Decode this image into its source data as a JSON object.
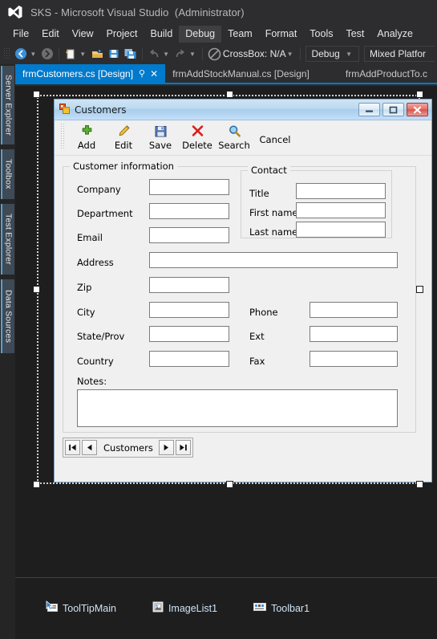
{
  "window": {
    "title": "SKS - Microsoft Visual Studio",
    "admin_suffix": "(Administrator)",
    "logo_icon": "visual-studio-logo-icon"
  },
  "menubar": {
    "items": [
      {
        "label": "File",
        "active": false
      },
      {
        "label": "Edit",
        "active": false
      },
      {
        "label": "View",
        "active": false
      },
      {
        "label": "Project",
        "active": false
      },
      {
        "label": "Build",
        "active": false
      },
      {
        "label": "Debug",
        "active": true
      },
      {
        "label": "Team",
        "active": false
      },
      {
        "label": "Format",
        "active": false
      },
      {
        "label": "Tools",
        "active": false
      },
      {
        "label": "Test",
        "active": false
      },
      {
        "label": "Analyze",
        "active": false
      }
    ]
  },
  "toolbar": {
    "nav_back_icon": "navigate-back-icon",
    "nav_forward_icon": "navigate-forward-icon",
    "new_project_icon": "new-project-icon",
    "open_file_icon": "open-file-icon",
    "save_icon": "save-icon",
    "save_all_icon": "save-all-icon",
    "undo_icon": "undo-icon",
    "redo_icon": "redo-icon",
    "start_icon": "start-debug-disabled-icon",
    "start_label": "CrossBox: N/A",
    "configuration": "Debug",
    "platform": "Mixed Platfor"
  },
  "left_dock": {
    "tabs": [
      {
        "label": "Server Explorer"
      },
      {
        "label": "Toolbox"
      },
      {
        "label": "Test Explorer"
      },
      {
        "label": "Data Sources"
      }
    ]
  },
  "tabstrip": {
    "tabs": [
      {
        "label": "frmCustomers.cs [Design]",
        "active": true,
        "pin_icon": "pin-icon",
        "close_icon": "close-icon"
      },
      {
        "label": "frmAddStockManual.cs [Design]",
        "active": false
      },
      {
        "label": "frmAddProductTo.c",
        "active": false
      }
    ]
  },
  "form": {
    "icon": "windows-form-icon",
    "title": "Customers",
    "titlebar_buttons": [
      {
        "name": "minimize",
        "glyph": "minimize-icon"
      },
      {
        "name": "maximize",
        "glyph": "maximize-icon"
      },
      {
        "name": "close",
        "glyph": "close-icon"
      }
    ],
    "toolbar": [
      {
        "label": "Add",
        "icon": "add-plus-icon"
      },
      {
        "label": "Edit",
        "icon": "edit-pencil-icon"
      },
      {
        "label": "Save",
        "icon": "save-floppy-icon"
      },
      {
        "label": "Delete",
        "icon": "delete-x-icon"
      },
      {
        "label": "Search",
        "icon": "search-magnifier-icon"
      },
      {
        "label": "Cancel",
        "icon": ""
      }
    ],
    "customer_group": {
      "title": "Customer information",
      "fields": [
        {
          "label": "Company",
          "value": ""
        },
        {
          "label": "Department",
          "value": ""
        },
        {
          "label": "Email",
          "value": ""
        },
        {
          "label": "Address",
          "value": ""
        },
        {
          "label": "Zip",
          "value": ""
        },
        {
          "label": "City",
          "value": ""
        },
        {
          "label": "State/Prov",
          "value": ""
        },
        {
          "label": "Country",
          "value": ""
        }
      ],
      "notes_label": "Notes:",
      "notes_value": ""
    },
    "contact_group": {
      "title": "Contact",
      "fields": [
        {
          "label": "Title",
          "value": ""
        },
        {
          "label": "First name",
          "value": ""
        },
        {
          "label": "Last name",
          "value": ""
        }
      ]
    },
    "phone_fields": [
      {
        "label": "Phone",
        "value": ""
      },
      {
        "label": "Ext",
        "value": ""
      },
      {
        "label": "Fax",
        "value": ""
      }
    ],
    "navigator": {
      "first_icon": "move-first-icon",
      "prev_icon": "move-previous-icon",
      "label": "Customers",
      "next_icon": "move-next-icon",
      "last_icon": "move-last-icon"
    }
  },
  "component_tray": {
    "items": [
      {
        "label": "ToolTipMain",
        "icon": "tooltip-component-icon"
      },
      {
        "label": "ImageList1",
        "icon": "imagelist-component-icon"
      },
      {
        "label": "Toolbar1",
        "icon": "toolbar-component-icon"
      }
    ]
  },
  "colors": {
    "accent": "#007acc",
    "shell_bg": "#2d2d30",
    "designer_bg": "#1e1e1e",
    "form_bg": "#f0f0f0"
  }
}
